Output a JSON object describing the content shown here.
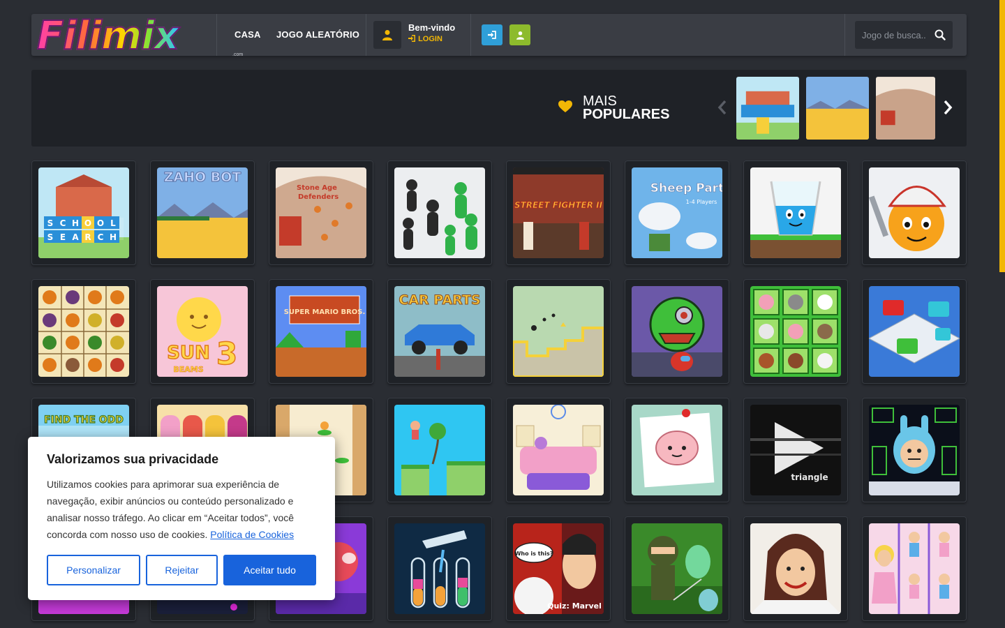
{
  "brand": {
    "logo_text": "Filimix",
    "logo_suffix": ".com",
    "accent": "#f2b705"
  },
  "nav": {
    "home": "CASA",
    "random": "JOGO ALEATÓRIO"
  },
  "user": {
    "welcome": "Bem-vindo",
    "login": "LOGIN"
  },
  "search": {
    "placeholder": "Jogo de busca.."
  },
  "popular": {
    "line1": "MAIS",
    "line2": "POPULARES"
  },
  "cookie": {
    "title": "Valorizamos sua privacidade",
    "text": "Utilizamos cookies para aprimorar sua experiência de navegação, exibir anúncios ou conteúdo personalizado e analisar nosso tráfego. Ao clicar em “Aceitar todos”, você concorda com nosso uso de cookies.",
    "link": "Política de Cookies",
    "customize": "Personalizar",
    "reject": "Rejeitar",
    "accept": "Aceitar tudo"
  },
  "game_thumbs": {
    "school": {
      "letters": [
        "S",
        "C",
        "H",
        "O",
        "O",
        "L"
      ],
      "letters2": [
        "S",
        "E",
        "A",
        "R",
        "C",
        "H"
      ]
    },
    "zaho": {
      "title": "ZAHO BOT"
    },
    "stone": {
      "title1": "Stone Age",
      "title2": "Defenders"
    },
    "street": {
      "title": "STREET FIGHTER II"
    },
    "sheep": {
      "title": "Sheep Party",
      "sub": "1-4 Players"
    },
    "sun": {
      "title": "SUN",
      "num": "3",
      "sub": "BEAMS"
    },
    "mario": {
      "title": "SUPER MARIO BROS."
    },
    "car": {
      "title": "CAR PARTS"
    },
    "odd": {
      "title": "FIND THE ODD"
    },
    "triangle": {
      "title": "triangle"
    },
    "quiz": {
      "title": "Quiz: Marvel",
      "bubble": "Who is this?"
    }
  }
}
